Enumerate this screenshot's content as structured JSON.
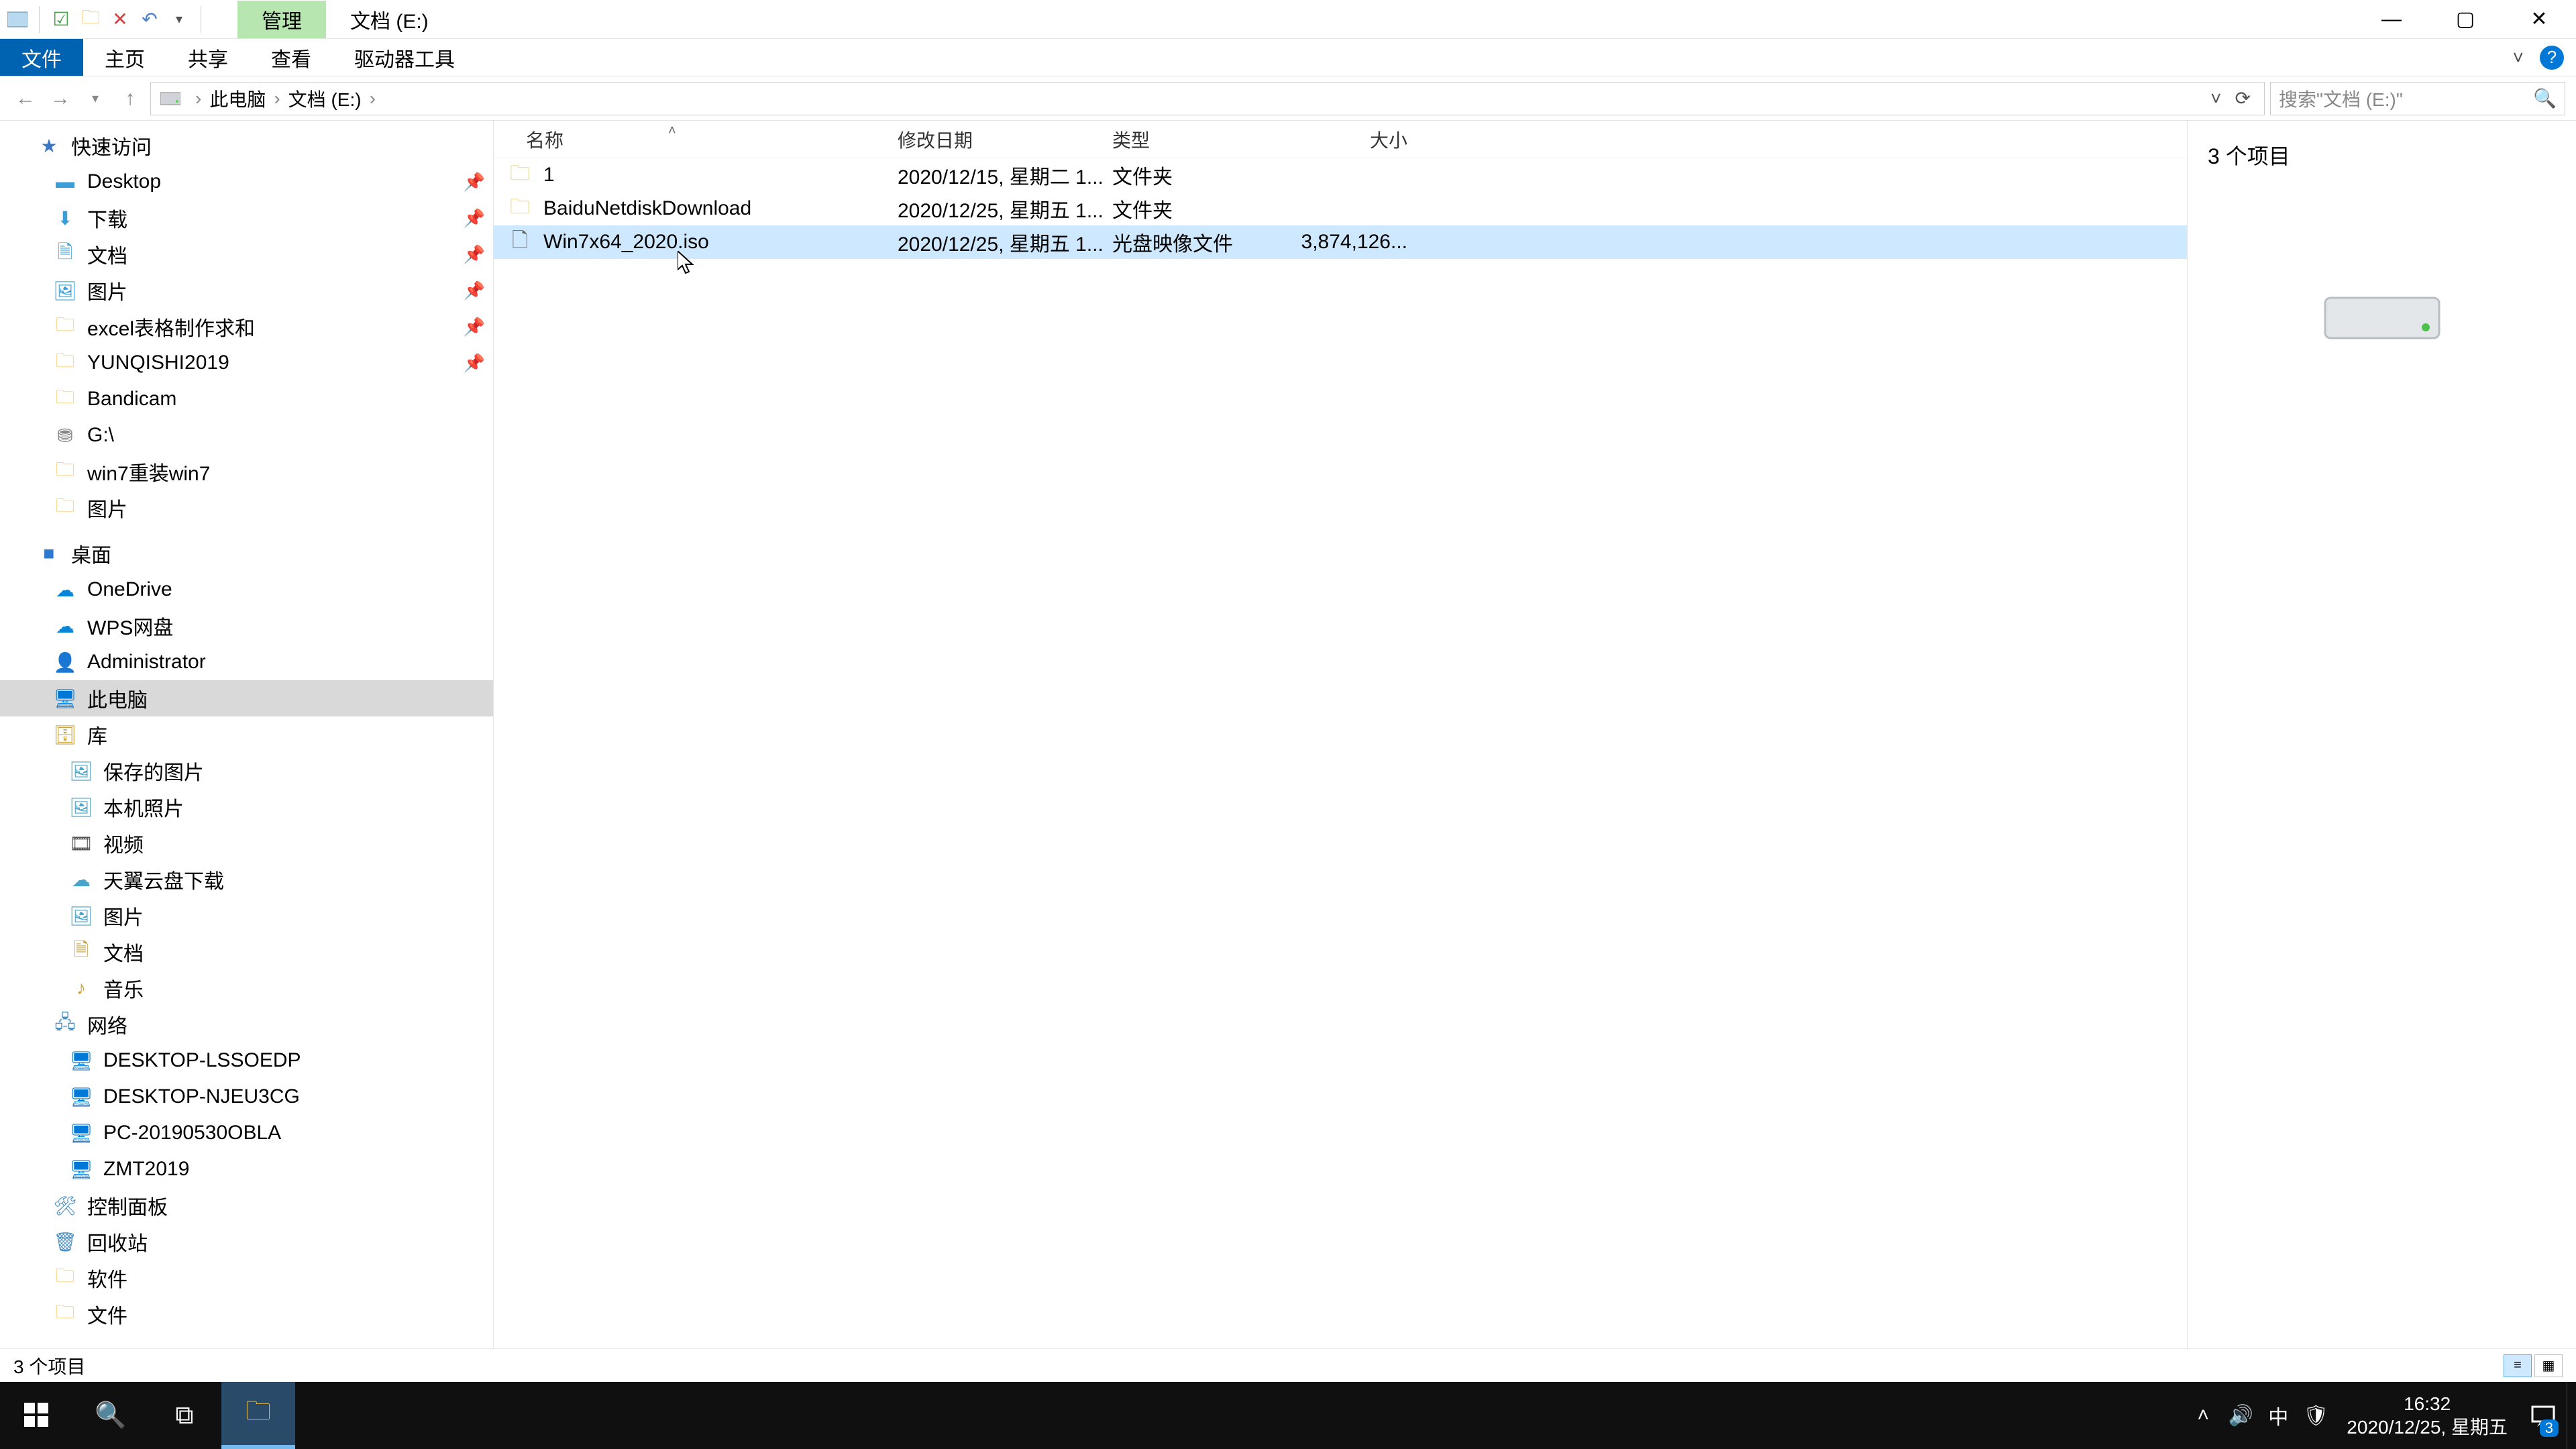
{
  "title_tabs": {
    "context": "管理",
    "location": "文档 (E:)"
  },
  "ribbon": {
    "file": "文件",
    "home": "主页",
    "share": "共享",
    "view": "查看",
    "drive_tools": "驱动器工具"
  },
  "breadcrumbs": {
    "root": "此电脑",
    "current": "文档 (E:)"
  },
  "search": {
    "placeholder": "搜索\"文档 (E:)\""
  },
  "columns": {
    "name": "名称",
    "date": "修改日期",
    "type": "类型",
    "size": "大小"
  },
  "rows": [
    {
      "name": "1",
      "date": "2020/12/15, 星期二 1...",
      "type": "文件夹",
      "size": "",
      "kind": "folder"
    },
    {
      "name": "BaiduNetdiskDownload",
      "date": "2020/12/25, 星期五 1...",
      "type": "文件夹",
      "size": "",
      "kind": "folder"
    },
    {
      "name": "Win7x64_2020.iso",
      "date": "2020/12/25, 星期五 1...",
      "type": "光盘映像文件",
      "size": "3,874,126...",
      "kind": "iso"
    }
  ],
  "preview": {
    "summary": "3 个项目"
  },
  "statusbar": {
    "text": "3 个项目"
  },
  "tree": {
    "quick_access": "快速访问",
    "quick_items": [
      {
        "label": "Desktop",
        "icon": "desktop",
        "pinned": true
      },
      {
        "label": "下载",
        "icon": "download",
        "pinned": true
      },
      {
        "label": "文档",
        "icon": "doc",
        "pinned": true
      },
      {
        "label": "图片",
        "icon": "pic",
        "pinned": true
      },
      {
        "label": "excel表格制作求和",
        "icon": "folder",
        "pinned": true
      },
      {
        "label": "YUNQISHI2019",
        "icon": "folder",
        "pinned": true
      },
      {
        "label": "Bandicam",
        "icon": "folder",
        "pinned": false
      },
      {
        "label": "G:\\",
        "icon": "drive",
        "pinned": false
      },
      {
        "label": "win7重装win7",
        "icon": "folder",
        "pinned": false
      },
      {
        "label": "图片",
        "icon": "folder",
        "pinned": false
      }
    ],
    "desktop": "桌面",
    "desktop_items": [
      {
        "label": "OneDrive",
        "icon": "cloud"
      },
      {
        "label": "WPS网盘",
        "icon": "cloud"
      },
      {
        "label": "Administrator",
        "icon": "user"
      },
      {
        "label": "此电脑",
        "icon": "pc",
        "selected": true
      },
      {
        "label": "库",
        "icon": "lib"
      }
    ],
    "lib_items": [
      {
        "label": "保存的图片"
      },
      {
        "label": "本机照片"
      },
      {
        "label": "视频"
      },
      {
        "label": "天翼云盘下载"
      },
      {
        "label": "图片"
      },
      {
        "label": "文档"
      },
      {
        "label": "音乐"
      }
    ],
    "network": "网络",
    "network_items": [
      {
        "label": "DESKTOP-LSSOEDP"
      },
      {
        "label": "DESKTOP-NJEU3CG"
      },
      {
        "label": "PC-20190530OBLA"
      },
      {
        "label": "ZMT2019"
      }
    ],
    "control_panel": "控制面板",
    "recycle": "回收站",
    "software": "软件",
    "docs": "文件"
  },
  "taskbar": {
    "ime": "中",
    "time": "16:32",
    "date": "2020/12/25, 星期五",
    "notif_count": "3"
  }
}
